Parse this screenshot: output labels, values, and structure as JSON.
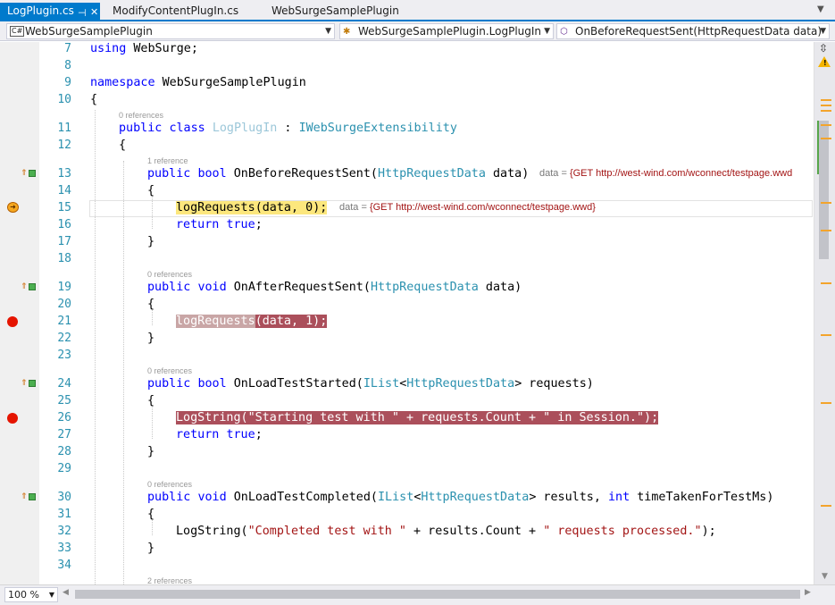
{
  "tabs": [
    {
      "label": "LogPlugin.cs",
      "state": "active"
    },
    {
      "label": "ModifyContentPlugIn.cs",
      "state": "open"
    },
    {
      "label": "WebSurgeSamplePlugin",
      "state": "preview"
    }
  ],
  "icons": {
    "pin": "pin-icon",
    "tab_close": "close-icon",
    "tab_dropdown": "chevron-down-icon",
    "breakpoint": "breakpoint-circle-icon",
    "instruction_pointer": "current-statement-arrow-icon",
    "method_glyph": "method-up-green-icon",
    "warning": "warning-triangle-icon"
  },
  "nav": {
    "project": "WebSurgeSamplePlugin",
    "class": "WebSurgeSamplePlugin.LogPlugIn",
    "member": "OnBeforeRequestSent(HttpRequestData data)",
    "project_badge": "C#"
  },
  "code_lenses": {
    "l11": "0 references",
    "l13": "1 reference",
    "l19": "0 references",
    "l24": "0 references",
    "l30": "0 references",
    "l35": "2 references"
  },
  "datatips": {
    "l13_label": "data = ",
    "l13_value": "{GET http://west-wind.com/wconnect/testpage.wwd",
    "l15_label": "data = ",
    "l15_value": "{GET http://west-wind.com/wconnect/testpage.wwd}"
  },
  "line_numbers": [
    "7",
    "8",
    "9",
    "10",
    "11",
    "12",
    "13",
    "14",
    "15",
    "16",
    "17",
    "18",
    "19",
    "20",
    "21",
    "22",
    "23",
    "24",
    "25",
    "26",
    "27",
    "28",
    "29",
    "30",
    "31",
    "32",
    "33",
    "34"
  ],
  "code": {
    "l7_kw": "using",
    "l7_rest": " WebSurge;",
    "l9_kw": "namespace",
    "l9_rest": " WebSurgeSamplePlugin",
    "l10": "{",
    "l11_kw1": "public",
    "l11_kw2": "class",
    "l11_name": "LogPlugIn",
    "l11_colon": " : ",
    "l11_iface": "IWebSurgeExtensibility",
    "l12": "{",
    "l13_kw1": "public",
    "l13_kw2": "bool",
    "l13_name": " OnBeforeRequestSent(",
    "l13_type": "HttpRequestData",
    "l13_tail": " data)",
    "l14": "{",
    "l15_call": "logRequests",
    "l15_args1": "(data, ",
    "l15_num": "0",
    "l15_args2": ");",
    "l16_kw1": "return",
    "l16_kw2": "true",
    "l16_tail": ";",
    "l17": "}",
    "l19_kw1": "public",
    "l19_kw2": "void",
    "l19_name": " OnAfterRequestSent(",
    "l19_type": "HttpRequestData",
    "l19_tail": " data)",
    "l20": "{",
    "l21_call": "logRequests",
    "l21_args": "(data, 1);",
    "l22": "}",
    "l24_kw1": "public",
    "l24_kw2": "bool",
    "l24_name": " OnLoadTestStarted(",
    "l24_type1": "IList",
    "l24_lt": "<",
    "l24_type2": "HttpRequestData",
    "l24_tail": "> requests)",
    "l25": "{",
    "l26_text": "LogString(\"Starting test with \" + requests.Count + \" in Session.\");",
    "l27_kw1": "return",
    "l27_kw2": "true",
    "l27_tail": ";",
    "l28": "}",
    "l30_kw1": "public",
    "l30_kw2": "void",
    "l30_name": " OnLoadTestCompleted(",
    "l30_type1": "IList",
    "l30_lt": "<",
    "l30_type2": "HttpRequestData",
    "l30_mid": "> results, ",
    "l30_kw3": "int",
    "l30_tail": " timeTakenForTestMs)",
    "l31": "{",
    "l32_call": "LogString(",
    "l32_str1": "\"Completed test with \"",
    "l32_mid": " + results.Count + ",
    "l32_str2": "\" requests processed.\"",
    "l32_tail": ");",
    "l33": "}"
  },
  "zoom": {
    "label": "100 %"
  },
  "colors": {
    "accent": "#007acc",
    "keyword": "#0000ff",
    "type": "#2b91af",
    "string": "#a31515",
    "breakpoint": "#e51400",
    "current_statement": "#fce77d",
    "breakpoint_line": "#ab4f5b"
  }
}
